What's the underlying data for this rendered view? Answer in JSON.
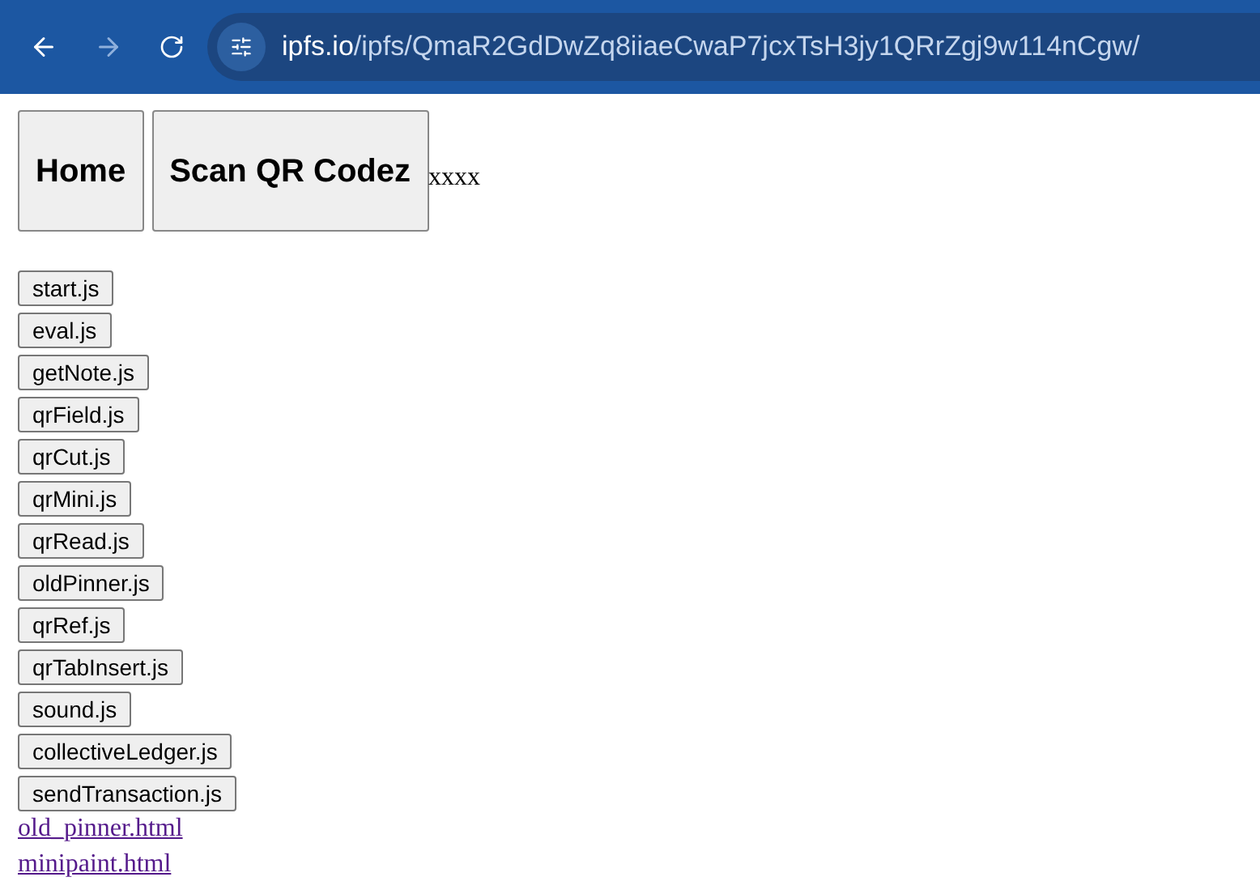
{
  "browser": {
    "url_domain": "ipfs.io",
    "url_path": "/ipfs/QmaR2GdDwZq8iiaeCwaP7jcxTsH3jy1QRrZgj9w114nCgw/"
  },
  "nav_buttons": [
    "Home",
    "Scan QR Codez"
  ],
  "nav_text": "xxxx",
  "script_buttons": [
    "start.js",
    "eval.js",
    "getNote.js",
    "qrField.js",
    "qrCut.js",
    "qrMini.js",
    "qrRead.js",
    "oldPinner.js",
    "qrRef.js",
    "qrTabInsert.js",
    "sound.js",
    "collectiveLedger.js",
    "sendTransaction.js"
  ],
  "links": [
    "old_pinner.html",
    "minipaint.html"
  ]
}
